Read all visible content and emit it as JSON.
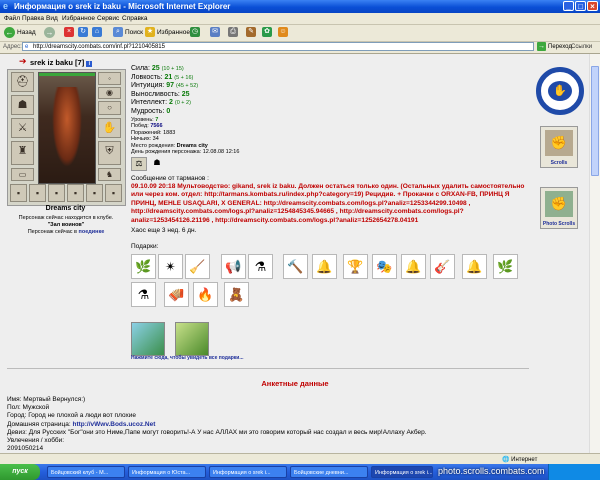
{
  "window": {
    "title": "Информация о srek iz baku - Microsoft Internet Explorer"
  },
  "menu": [
    "Файл",
    "Правка",
    "Вид",
    "Избранное",
    "Сервис",
    "Справка"
  ],
  "toolbar": {
    "back": "Назад",
    "search": "Поиск",
    "favorites": "Избранное"
  },
  "address": {
    "label": "Адрес:",
    "url": "http://dreamscity.combats.com/inf.pl?1210405815",
    "go": "Переход",
    "links": "Ссылки"
  },
  "profile": {
    "name": "srek iz baku",
    "level": "[7]",
    "city_title": "Dreams city",
    "club_line1": "Персонаж сейчас находится в клубе.",
    "club_line2": "\"Зал воинов\"",
    "club_line3_prefix": "Персонаж сейчас в",
    "club_line3_link": "поединке",
    "stats": [
      {
        "label": "Сила:",
        "value": "25",
        "extra": "(10 + 15)"
      },
      {
        "label": "Ловкость:",
        "value": "21",
        "extra": "(5 + 16)"
      },
      {
        "label": "Интуиция:",
        "value": "97",
        "extra": "(45 + 52)"
      },
      {
        "label": "Выносливость:",
        "value": "25",
        "extra": ""
      },
      {
        "label": "Интеллект:",
        "value": "2",
        "extra": "(0 + 2)"
      },
      {
        "label": "Мудрость:",
        "value": "0",
        "extra": ""
      }
    ],
    "details": [
      {
        "label": "Уровень:",
        "value": "7"
      },
      {
        "label": "Побед:",
        "value": "7566"
      },
      {
        "label": "Поражений:",
        "value": "1883"
      },
      {
        "label": "Ничьих:",
        "value": "34"
      },
      {
        "label": "Место рождения:",
        "value": "Dreams city"
      },
      {
        "label": "День рождения персонажа:",
        "value": "12.08.08 12:16"
      }
    ]
  },
  "message": {
    "label": "Сообщение от тарманов :",
    "text": "09.10.09 20:18 Мультоводство: gikand, srek iz baku. Должен остаться только один. (Остальных удалить самостоятельно или через ком. отдел: http://tarmans.kombats.ru/index.php?category=19) Рецидив. + Прокачки с ORXAN-FB, ПРИНЦ Я ПРИНЦ, MEHLE USAQLARI, X GENERAL: http://dreamscity.combats.com/logs.pl?analiz=1253344299.10498 , http://dreamscity.combats.com/logs.pl?analiz=1254845345.94665 , http://dreamscity.combats.com/logs.pl?analiz=1253454126.21196 , http://dreamscity.combats.com/logs.pl?analiz=1252654278.04191",
    "chaos": "Хаос еще 3 нед. 6 дн."
  },
  "gifts": {
    "label": "Подарки:",
    "icons": [
      "🌿",
      "✴",
      "🧹",
      "📢",
      "⚗",
      "🔨",
      "🔔",
      "🏆",
      "🎭",
      "🔔",
      "🎸",
      "🔔",
      "🌿",
      "⚗",
      "🪗",
      "🔥",
      "🧸"
    ],
    "cards_caption": "Нажмите сюда, чтобы увидеть все подарки..."
  },
  "sidebar": {
    "scrolls": "Scrolls",
    "photo_scrolls": "Photo Scrolls"
  },
  "anketa": {
    "title": "Анкетные данные",
    "name": "Имя: Мертвый Вернулся:)",
    "gender": "Пол: Мужской",
    "city": "Город: Город не плохой а люди вот плохие",
    "homepage_prefix": "Домашняя страница:",
    "homepage_link": "http://vWwv.Bods.ucoz.Net",
    "motto": "Девиз: Для Русских \"Бог\"они это Ниме,Папе могут говорить!-А У нас АЛЛАХ ми это говорим который нас создал и весь мир!Аллаху Акбер.",
    "hobbies": "Увлечения / хобби:",
    "hobbies_value": "2091050214"
  },
  "statusbar": {
    "zone": "Интернет"
  },
  "taskbar": {
    "start": "пуск",
    "tasks": [
      "Бойцовский клуб - М...",
      "Информация о Юста...",
      "Информация о srek i...",
      "Бойцовские дневни...",
      "Информация о srek i..."
    ],
    "watermark": "photo.scrolls.combats.com"
  }
}
